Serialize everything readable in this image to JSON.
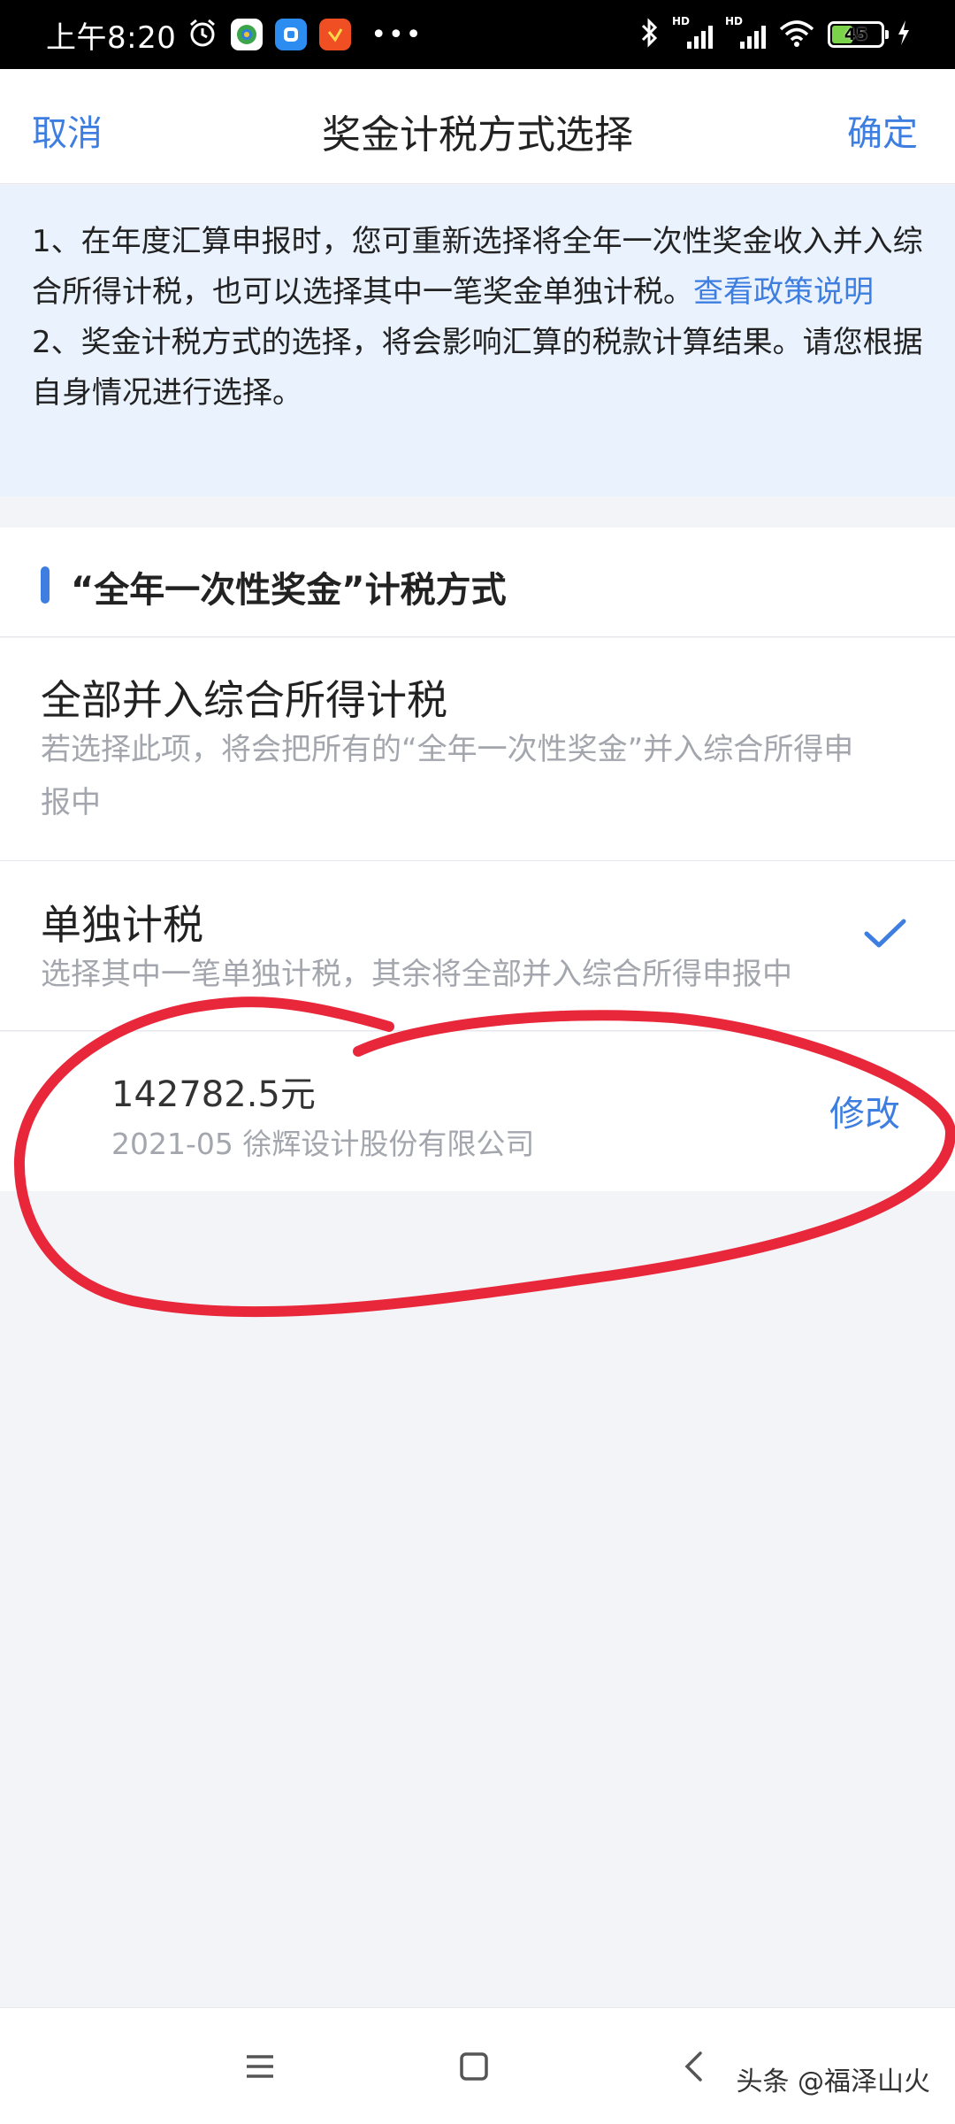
{
  "status_bar": {
    "time": "上午8:20",
    "battery": "45",
    "icons": [
      "alarm-icon",
      "app-icon-colorful",
      "app-icon-blue",
      "app-icon-orange",
      "more-dots-icon",
      "bluetooth-icon",
      "signal-hd-icon",
      "signal-hd-icon",
      "wifi-icon",
      "battery-icon",
      "charging-icon"
    ],
    "more": "•••"
  },
  "header": {
    "cancel_label": "取消",
    "title": "奖金计税方式选择",
    "confirm_label": "确定"
  },
  "notice": {
    "line1_text": "1、在年度汇算申报时，您可重新选择将全年一次性奖金收入并入综合所得计税，也可以选择其中一笔奖金单独计税。",
    "policy_link": "查看政策说明",
    "line2_text": "2、奖金计税方式的选择，将会影响汇算的税款计算结果。请您根据自身情况进行选择。"
  },
  "section": {
    "title": "“全年一次性奖金”计税方式"
  },
  "options": [
    {
      "title": "全部并入综合所得计税",
      "desc": "若选择此项，将会把所有的“全年一次性奖金”并入综合所得申报中",
      "selected": false
    },
    {
      "title": "单独计税",
      "desc": "选择其中一笔单独计税，其余将全部并入综合所得申报中",
      "selected": true
    }
  ],
  "bonus_item": {
    "amount": "142782.5元",
    "detail": "2021-05 徐辉设计股份有限公司",
    "edit_label": "修改"
  },
  "watermark": "头条 @福泽山火",
  "colors": {
    "accent": "#3d7ee0",
    "notice_bg": "#e9f2fd",
    "page_bg": "#f3f4f8",
    "annotation_red": "#e8283a"
  }
}
